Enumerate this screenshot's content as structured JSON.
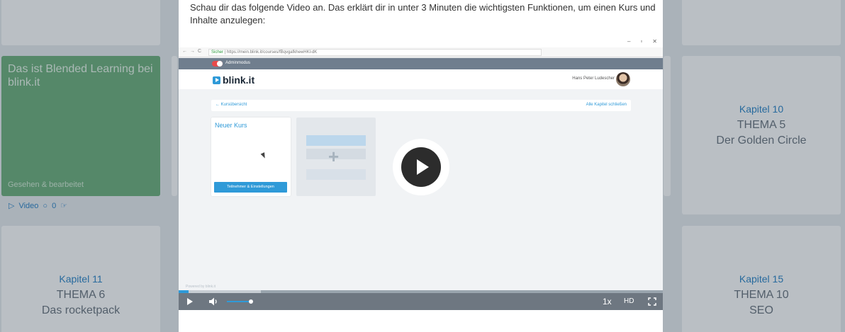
{
  "intro_text": "Schau dir das folgende Video an. Das erklärt dir in unter 3 Minuten die wichtigsten Funktionen, um einen Kurs und Inhalte anzulegen:",
  "background_cards": [
    {
      "kapitel": "Kapitel 10",
      "thema": "THEMA 5",
      "subtitle": "Der Golden Circle"
    },
    {
      "kapitel": "Kapitel 11",
      "thema": "THEMA 6",
      "subtitle": "Das rocketpack"
    },
    {
      "kapitel": "Kapitel 15",
      "thema": "THEMA 10",
      "subtitle": "SEO"
    }
  ],
  "featured_card": {
    "title": "Das ist Blended Learning bei blink.it",
    "status": "Gesehen & bearbeitet",
    "type_label": "Video",
    "comment_count": "0"
  },
  "video": {
    "window_controls": [
      "–",
      "▫",
      "✕"
    ],
    "address_secure": "Sicher",
    "address_url": "https://mein.blink.it/courses/fBqvgafkhewHKl-dK",
    "admin_mode_label": "Adminmodus",
    "logo_text": "blink.it",
    "user_name": "Hans Peter Ludescher",
    "back_link": "← Kursübersicht",
    "close_chapters": "Alle Kapitel schließen",
    "course_title": "Neuer Kurs",
    "course_button": "Teilnehmer & Einstellungen",
    "powered_by": "Powered by blink.it",
    "progress": 0.02,
    "buffered": 0.17,
    "volume": 1.0,
    "speed_label": "1x",
    "quality_label": "HD"
  },
  "colors": {
    "accent": "#2f9ad8",
    "controls_bg": "#6e7781",
    "featured_card_bg": "#6fb07d"
  }
}
